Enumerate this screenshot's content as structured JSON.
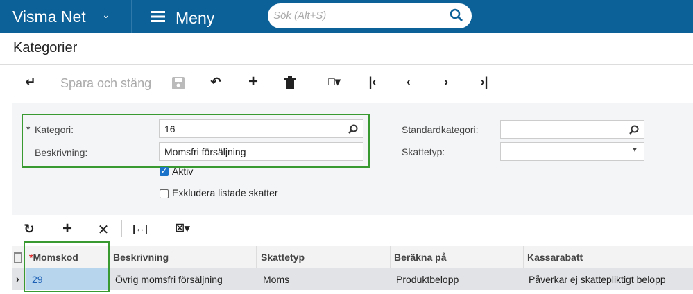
{
  "header": {
    "brand": "Visma Net",
    "menu": "Meny",
    "search_placeholder": "Sök (Alt+S)"
  },
  "page": {
    "title": "Kategorier"
  },
  "toolbar": {
    "save_close": "Spara och stäng"
  },
  "form": {
    "kategori_label": "Kategori:",
    "kategori_value": "16",
    "required_mark": "*",
    "beskrivning_label": "Beskrivning:",
    "beskrivning_value": "Momsfri försäljning",
    "aktiv_label": "Aktiv",
    "aktiv_checked": true,
    "exkludera_label": "Exkludera listade skatter",
    "exkludera_checked": false,
    "standardkategori_label": "Standardkategori:",
    "standardkategori_value": "",
    "skattetyp_label": "Skattetyp:",
    "skattetyp_value": ""
  },
  "grid": {
    "columns": [
      "Momskod",
      "Beskrivning",
      "Skattetyp",
      "Beräkna på",
      "Kassarabatt"
    ],
    "rows": [
      [
        "29",
        "Övrig momsfri försäljning",
        "Moms",
        "Produktbelopp",
        "Påverkar ej skattepliktigt belopp"
      ]
    ]
  },
  "colors": {
    "header": "#0d6199",
    "highlight": "#3a9a32",
    "selected_cell": "#b8d5ee"
  }
}
